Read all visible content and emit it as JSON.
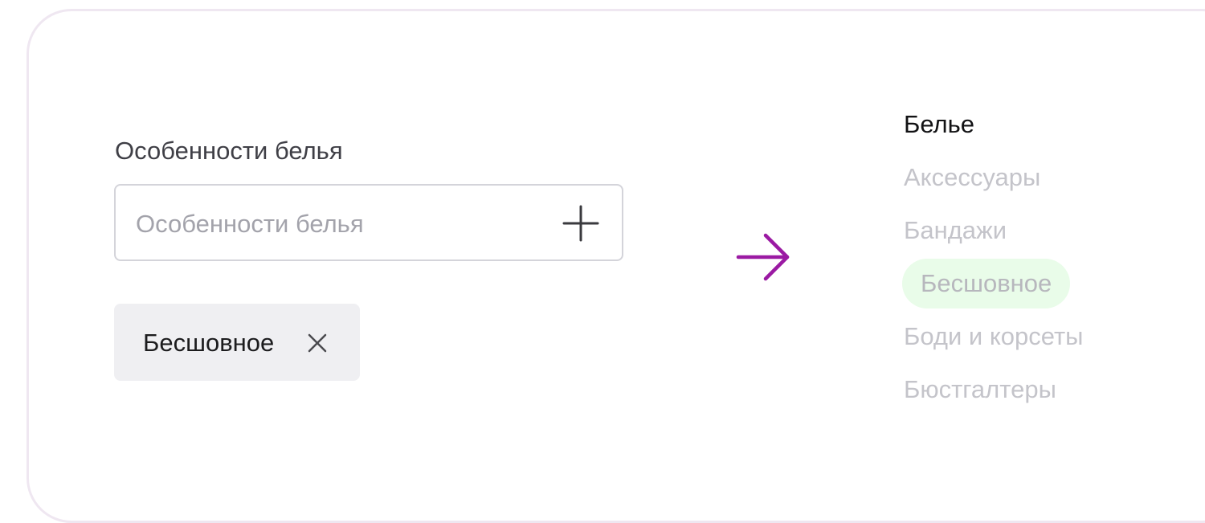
{
  "colors": {
    "frame_border": "#efe7f1",
    "arrow": "#9b1aa3",
    "chip_bg": "#efeff2",
    "highlight_bg": "#e9fce9",
    "muted_text": "#c4c4ca"
  },
  "field": {
    "label": "Особенности белья",
    "placeholder": "Особенности белья",
    "add_icon": "plus-icon"
  },
  "chip": {
    "label": "Бесшовное",
    "remove_icon": "close-icon"
  },
  "arrow_icon": "arrow-right-icon",
  "categories": {
    "items": [
      {
        "label": "Белье",
        "state": "active"
      },
      {
        "label": "Аксессуары",
        "state": "muted"
      },
      {
        "label": "Бандажи",
        "state": "muted"
      },
      {
        "label": "Бесшовное",
        "state": "highlighted"
      },
      {
        "label": "Боди и корсеты",
        "state": "muted"
      },
      {
        "label": "Бюстгалтеры",
        "state": "muted"
      }
    ]
  }
}
